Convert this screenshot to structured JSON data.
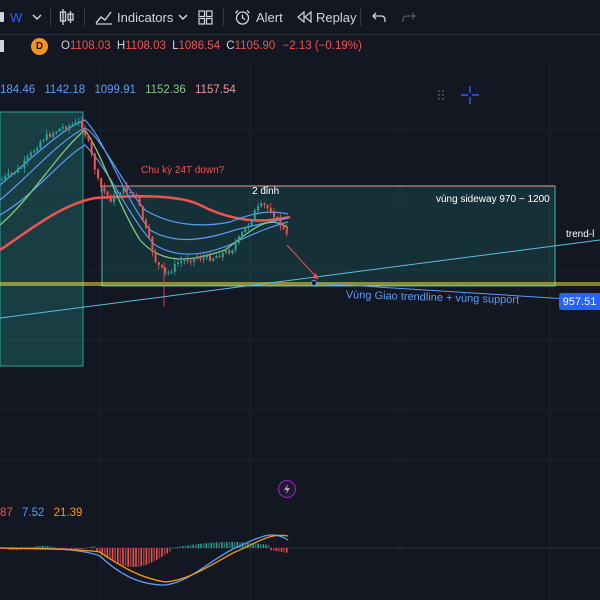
{
  "toolbar": {
    "interval": "W",
    "indicators_label": "Indicators",
    "alert_label": "Alert",
    "replay_label": "Replay"
  },
  "infobar": {
    "symbol_badge": "D",
    "open_label": "O",
    "open": "1108.03",
    "high_label": "H",
    "high": "1108.03",
    "low_label": "L",
    "low": "1086.54",
    "close_label": "C",
    "close": "1105.90",
    "change": "−2.13 (−0.19%)"
  },
  "ma_values": [
    "184.46",
    "1142.18",
    "1099.91",
    "1152.36",
    "1157.54"
  ],
  "ma_colors": [
    "#5b9cf6",
    "#5b9cf6",
    "#5b9cf6",
    "#81c784",
    "#ef9a9a"
  ],
  "annotations": {
    "cycle_question": "Chu kỳ 24T down?",
    "two_peaks": "2 đỉnh",
    "sideway_zone": "vùng sideway 970 ~ 1200",
    "trendline": "trend-l",
    "confluence": "Vùng Giao trendline + vùng support",
    "price_tag": "957.51"
  },
  "macd_legend": [
    "87",
    "7.52",
    "21.39"
  ],
  "macd_colors": [
    "#ef5350",
    "#5b9cf6",
    "#ff9800"
  ],
  "colors": {
    "background": "#131722",
    "up": "#26a69a",
    "down": "#ef5350",
    "accent": "#2962ff"
  },
  "icons": [
    "candles-icon",
    "indicators-icon",
    "chevron-down-icon",
    "layout-grid-icon",
    "alert-clock-icon",
    "replay-icon",
    "undo-icon",
    "redo-icon",
    "crosshair-icon",
    "lightning-icon"
  ]
}
